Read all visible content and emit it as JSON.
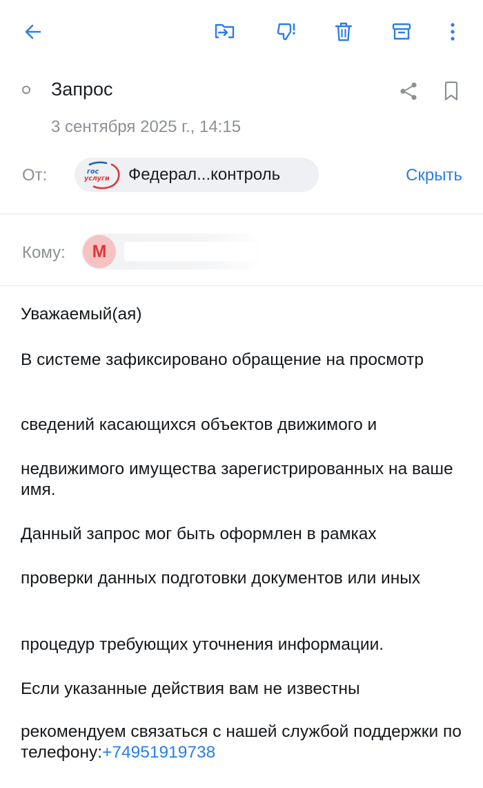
{
  "toolbar": {
    "icons": [
      "back-arrow-icon",
      "move-to-folder-icon",
      "spam-icon",
      "trash-icon",
      "archive-icon",
      "more-vertical-icon"
    ],
    "accent_color": "#2b7de9"
  },
  "message": {
    "subject": "Запрос",
    "date": "3 сентября 2025 г., 14:15",
    "from_label": "От:",
    "sender_name": "Федерал...контроль",
    "sender_logo_text_top": "гос",
    "sender_logo_text_bottom": "услуги",
    "hide_label": "Скрыть",
    "to_label": "Кому:",
    "recipient_initial": "М",
    "body": [
      "Уважаемый(ая)",
      "В системе зафиксировано обращение на просмотр",
      "сведений касающихся объектов движимого и",
      "недвижимого имущества зарегистрированных на ваше имя.",
      "Данный запрос мог быть оформлен в рамках",
      "проверки данных подготовки документов или иных",
      "процедур требующих уточнения информации.",
      "Если указанные действия вам не известны",
      "рекомендуем связаться с нашей службой поддержки по телефону:"
    ],
    "phone": "+74951919738"
  }
}
